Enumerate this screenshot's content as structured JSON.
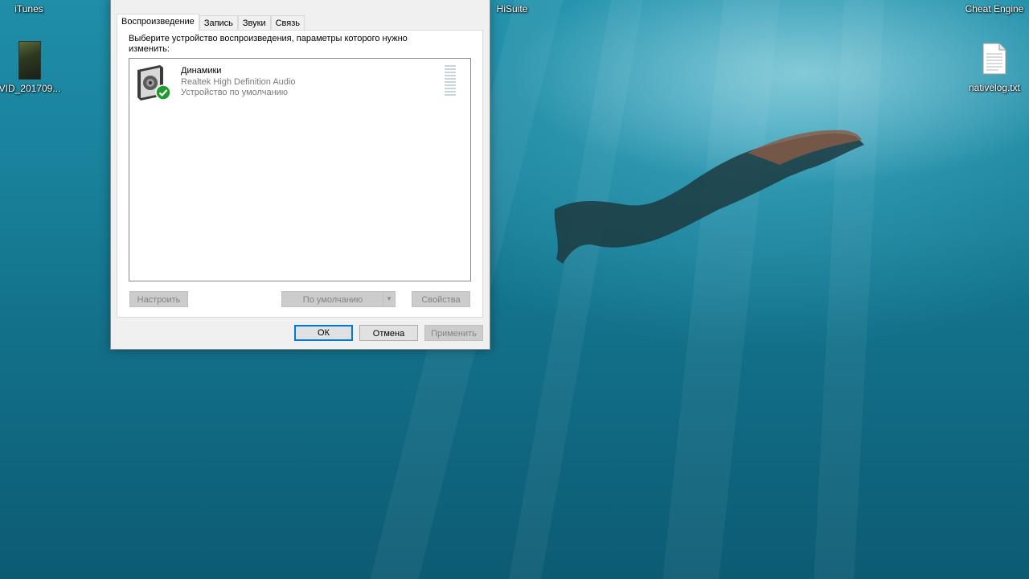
{
  "desktop": {
    "icons": [
      {
        "label": "iTunes",
        "icon": "itunes-icon"
      },
      {
        "label": "VID_201709...",
        "icon": "video-thumbnail-icon"
      },
      {
        "label": "HiSuite",
        "icon": "hisuite-icon"
      },
      {
        "label": "Cheat Engine",
        "icon": "cheat-engine-icon"
      },
      {
        "label": "nativelog.txt",
        "icon": "text-file-icon"
      }
    ]
  },
  "dialog": {
    "tabs": [
      {
        "label": "Воспроизведение",
        "active": true
      },
      {
        "label": "Запись",
        "active": false
      },
      {
        "label": "Звуки",
        "active": false
      },
      {
        "label": "Связь",
        "active": false
      }
    ],
    "instruction": "Выберите устройство воспроизведения, параметры которого нужно изменить:",
    "devices": [
      {
        "name": "Динамики",
        "driver": "Realtek High Definition Audio",
        "status": "Устройство по умолчанию",
        "icon": "speaker-icon",
        "badge": "default-check-icon"
      }
    ],
    "buttons": {
      "configure": "Настроить",
      "set_default": "По умолчанию",
      "properties": "Свойства",
      "ok": "ОК",
      "cancel": "Отмена",
      "apply": "Применить"
    }
  },
  "colors": {
    "accent": "#0078d7",
    "check_green": "#1f9b2e",
    "water_top": "#1f8ea8",
    "water_bottom": "#0c5b73"
  }
}
